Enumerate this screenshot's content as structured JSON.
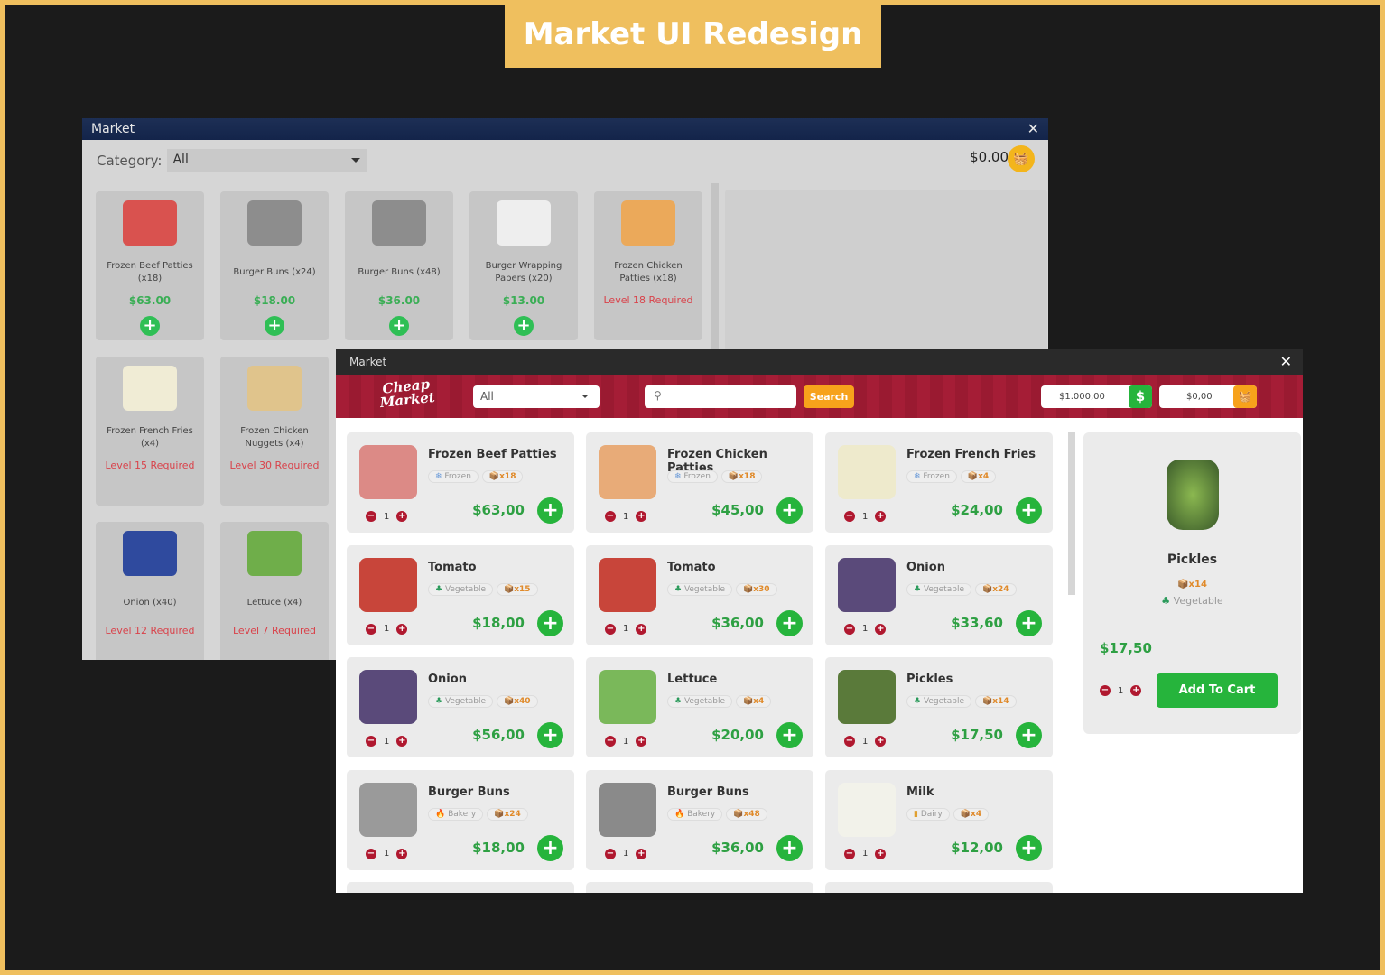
{
  "banner": "Market UI Redesign",
  "old_window": {
    "title": "Market",
    "close": "✕",
    "category_label": "Category:",
    "category_value": "All",
    "balance": "$0.00",
    "cart_icon": "basket-icon",
    "items": [
      {
        "name": "Frozen Beef Patties (x18)",
        "price": "$63.00",
        "color": "#d9524f"
      },
      {
        "name": "Burger Buns (x24)",
        "price": "$18.00",
        "color": "#8d8d8d"
      },
      {
        "name": "Burger Buns (x48)",
        "price": "$36.00",
        "color": "#8d8d8d"
      },
      {
        "name": "Burger Wrapping Papers (x20)",
        "price": "$13.00",
        "color": "#eeeeee"
      },
      {
        "name": "Frozen Chicken Patties (x18)",
        "locked": "Level 18 Required",
        "color": "#eba95a"
      },
      {
        "name": "Frozen French Fries (x4)",
        "locked": "Level 15 Required",
        "color": "#f0ecd5"
      },
      {
        "name": "Frozen Chicken Nuggets (x4)",
        "locked": "Level 30 Required",
        "color": "#e0c48c"
      },
      {
        "name": "Onion (x40)",
        "locked": "Level 12 Required",
        "color": "#2f4a9e"
      },
      {
        "name": "Lettuce (x4)",
        "locked": "Level 7 Required",
        "color": "#6fae4a"
      }
    ]
  },
  "new_window": {
    "title": "Market",
    "close": "✕",
    "logo": "Cheap Market",
    "category_value": "All",
    "search_placeholder": "",
    "search_button": "Search",
    "balance": "$1.000,00",
    "cart_total": "$0,00",
    "items": [
      {
        "name": "Frozen Beef Patties",
        "category": "Frozen",
        "category_icon": "snowflake-icon",
        "qty": "x18",
        "price": "$63,00",
        "count": "1",
        "color": "#dc8a86"
      },
      {
        "name": "Frozen Chicken Patties",
        "category": "Frozen",
        "category_icon": "snowflake-icon",
        "qty": "x18",
        "price": "$45,00",
        "count": "1",
        "color": "#e8ab78"
      },
      {
        "name": "Frozen French Fries",
        "category": "Frozen",
        "category_icon": "snowflake-icon",
        "qty": "x4",
        "price": "$24,00",
        "count": "1",
        "color": "#eeeacc"
      },
      {
        "name": "Tomato",
        "category": "Vegetable",
        "category_icon": "broccoli-icon",
        "qty": "x15",
        "price": "$18,00",
        "count": "1",
        "color": "#c8453a"
      },
      {
        "name": "Tomato",
        "category": "Vegetable",
        "category_icon": "broccoli-icon",
        "qty": "x30",
        "price": "$36,00",
        "count": "1",
        "color": "#c8453a"
      },
      {
        "name": "Onion",
        "category": "Vegetable",
        "category_icon": "broccoli-icon",
        "qty": "x24",
        "price": "$33,60",
        "count": "1",
        "color": "#5a4a7a"
      },
      {
        "name": "Onion",
        "category": "Vegetable",
        "category_icon": "broccoli-icon",
        "qty": "x40",
        "price": "$56,00",
        "count": "1",
        "color": "#5a4a7a"
      },
      {
        "name": "Lettuce",
        "category": "Vegetable",
        "category_icon": "broccoli-icon",
        "qty": "x4",
        "price": "$20,00",
        "count": "1",
        "color": "#7ab85a"
      },
      {
        "name": "Pickles",
        "category": "Vegetable",
        "category_icon": "broccoli-icon",
        "qty": "x14",
        "price": "$17,50",
        "count": "1",
        "color": "#5a7a3a"
      },
      {
        "name": "Burger Buns",
        "category": "Bakery",
        "category_icon": "flame-icon",
        "qty": "x24",
        "price": "$18,00",
        "count": "1",
        "color": "#9a9a9a"
      },
      {
        "name": "Burger Buns",
        "category": "Bakery",
        "category_icon": "flame-icon",
        "qty": "x48",
        "price": "$36,00",
        "count": "1",
        "color": "#8a8a8a"
      },
      {
        "name": "Milk",
        "category": "Dairy",
        "category_icon": "milk-icon",
        "qty": "x4",
        "price": "$12,00",
        "count": "1",
        "color": "#f2f2ea"
      }
    ],
    "detail": {
      "name": "Pickles",
      "qty": "x14",
      "category": "Vegetable",
      "price": "$17,50",
      "count": "1",
      "add_to_cart": "Add To Cart"
    }
  },
  "colors": {
    "accent_red": "#a51d36",
    "green": "#26b43c",
    "orange": "#f7a21b",
    "banner": "#efbf5e"
  }
}
